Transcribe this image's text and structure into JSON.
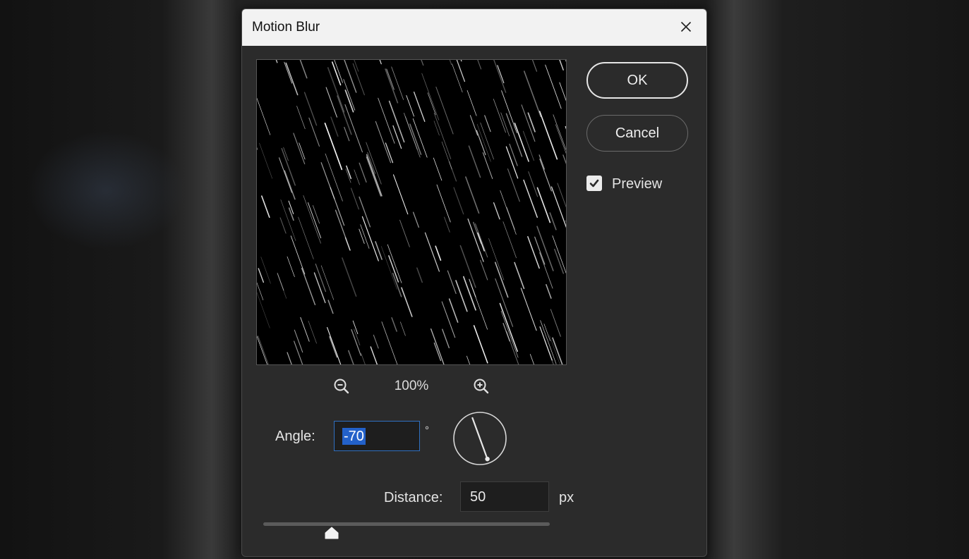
{
  "dialog": {
    "title": "Motion Blur",
    "close_icon": "close-icon"
  },
  "buttons": {
    "ok_label": "OK",
    "cancel_label": "Cancel"
  },
  "preview_option": {
    "label": "Preview",
    "checked": true
  },
  "zoom": {
    "level": "100%",
    "zoom_out_icon": "zoom-out-icon",
    "zoom_in_icon": "zoom-in-icon"
  },
  "angle": {
    "label": "Angle:",
    "value": "-70",
    "unit": "°",
    "dial_icon": "angle-dial-icon"
  },
  "distance": {
    "label": "Distance:",
    "value": "50",
    "unit": "px",
    "slider_fraction": 0.24
  },
  "colors": {
    "dialog_bg": "#2b2b2b",
    "titlebar_bg": "#f2f2f2",
    "selection_blue": "#2361c9",
    "focus_border": "#2f6fc0"
  }
}
